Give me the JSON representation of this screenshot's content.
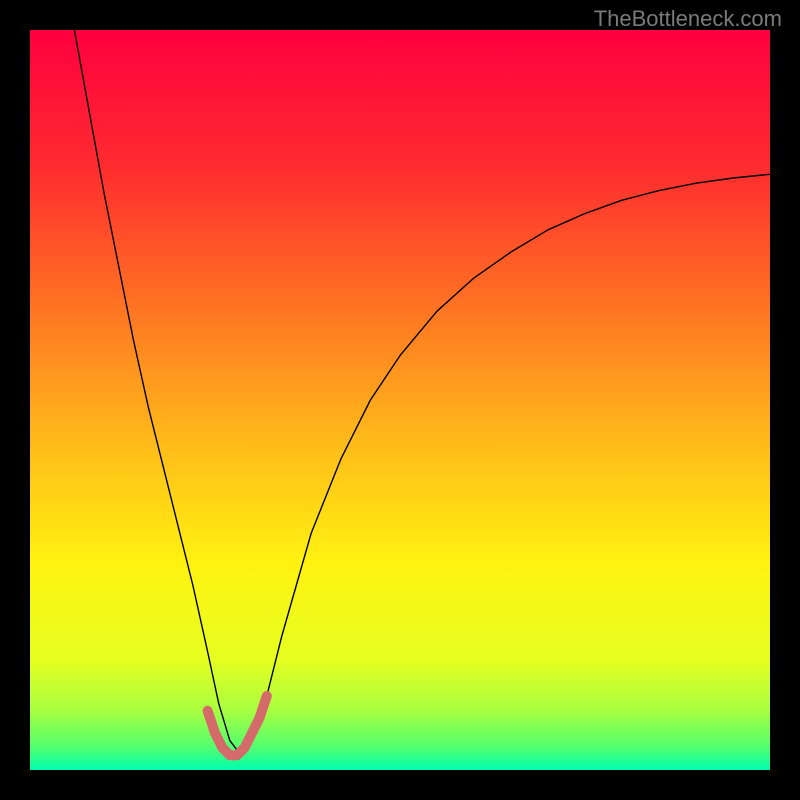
{
  "watermark": "TheBottleneck.com",
  "chart_data": {
    "type": "line",
    "title": "",
    "xlabel": "",
    "ylabel": "",
    "xlim": [
      0,
      100
    ],
    "ylim": [
      0,
      100
    ],
    "grid": false,
    "legend": false,
    "background": {
      "type": "vertical-gradient",
      "stops": [
        {
          "pos": 0.0,
          "color": "#ff0040"
        },
        {
          "pos": 0.18,
          "color": "#ff2a2f"
        },
        {
          "pos": 0.35,
          "color": "#ff6a24"
        },
        {
          "pos": 0.55,
          "color": "#ffb81a"
        },
        {
          "pos": 0.72,
          "color": "#fff210"
        },
        {
          "pos": 0.85,
          "color": "#e6ff20"
        },
        {
          "pos": 0.92,
          "color": "#a8ff40"
        },
        {
          "pos": 0.97,
          "color": "#50ff70"
        },
        {
          "pos": 1.0,
          "color": "#00ffb0"
        }
      ]
    },
    "series": [
      {
        "name": "bottleneck-curve",
        "color": "#000000",
        "stroke_width": 1.4,
        "x": [
          6,
          8,
          10,
          12,
          14,
          16,
          18,
          20,
          22,
          24,
          25.5,
          27,
          28.5,
          30,
          32,
          34,
          36,
          38,
          42,
          46,
          50,
          55,
          60,
          65,
          70,
          75,
          80,
          85,
          90,
          95,
          100
        ],
        "y": [
          100,
          89,
          78,
          68,
          58,
          49,
          41,
          33,
          25,
          16,
          9,
          4,
          2,
          4,
          10,
          18,
          25,
          32,
          42,
          50,
          56,
          62,
          66.5,
          70,
          73,
          75.2,
          77,
          78.3,
          79.3,
          80.0,
          80.5
        ]
      },
      {
        "name": "highlight-dip",
        "color": "#d46a6a",
        "stroke_width": 10,
        "x": [
          24,
          25,
          26,
          27,
          28,
          29,
          30,
          31,
          32
        ],
        "y": [
          8,
          5,
          3,
          2,
          2,
          3,
          5,
          7,
          10
        ]
      }
    ]
  }
}
